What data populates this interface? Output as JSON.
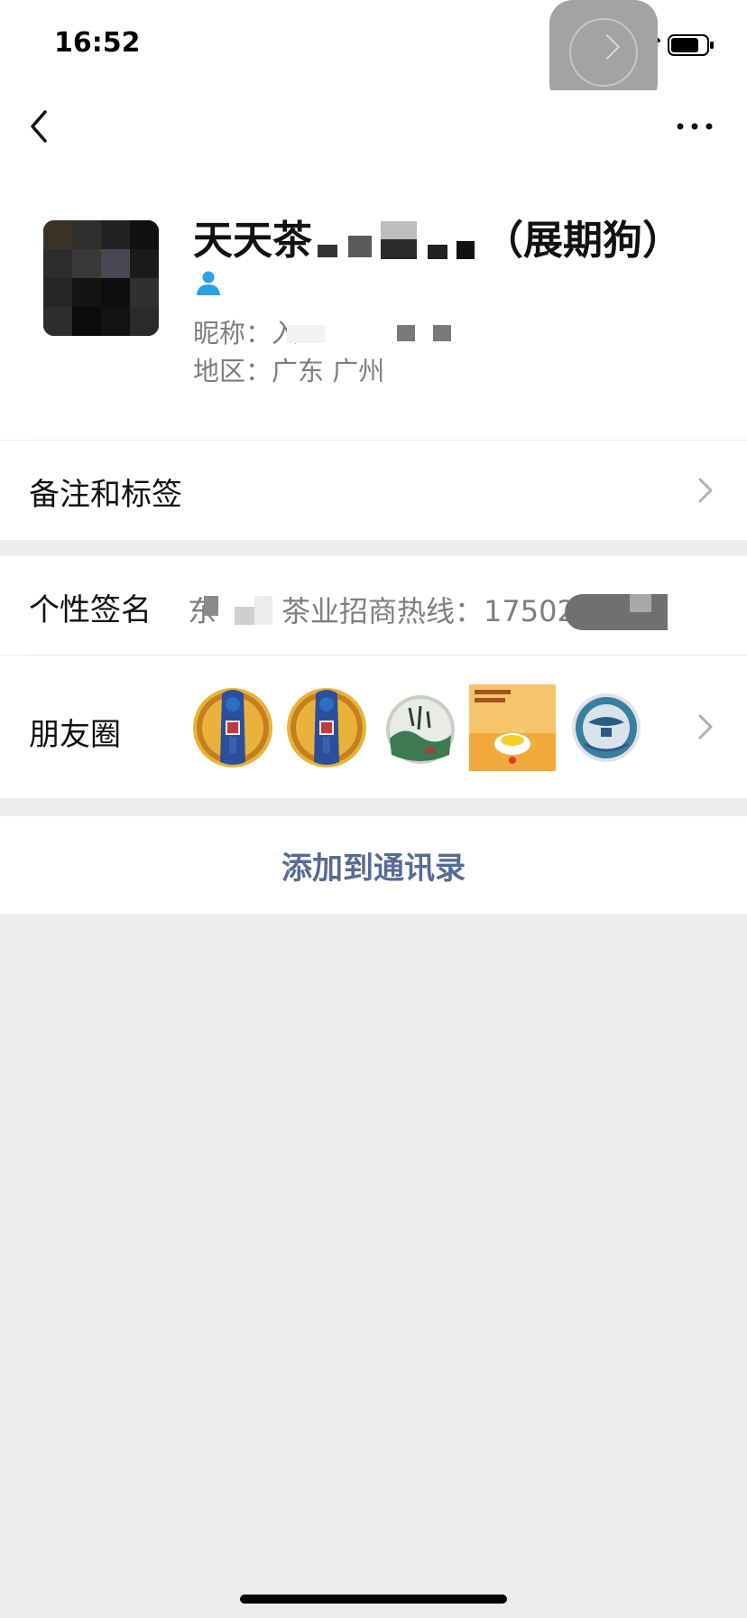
{
  "status_bar": {
    "time": "16:52"
  },
  "profile": {
    "name": "天天茶",
    "name_suffix": "（展期狗）",
    "nickname_label": "昵称：入",
    "region_label": "地区：广东 广州"
  },
  "rows": {
    "remark_label": "备注和标签",
    "signature_label": "个性签名",
    "signature_value_start": "东",
    "signature_value": "茶业招商热线：",
    "signature_phone": "175020",
    "moments_label": "朋友圈"
  },
  "actions": {
    "add_contact": "添加到通讯录"
  },
  "icons": {
    "back": "chevron-left-icon",
    "more": "more-dots-icon",
    "contact": "person-icon",
    "chevron": "chevron-right-icon"
  },
  "colors": {
    "link": "#576b95",
    "background": "#ededed",
    "card": "#ffffff",
    "secondary_text": "#7f7f7f",
    "contact_icon": "#2aa1e9"
  }
}
